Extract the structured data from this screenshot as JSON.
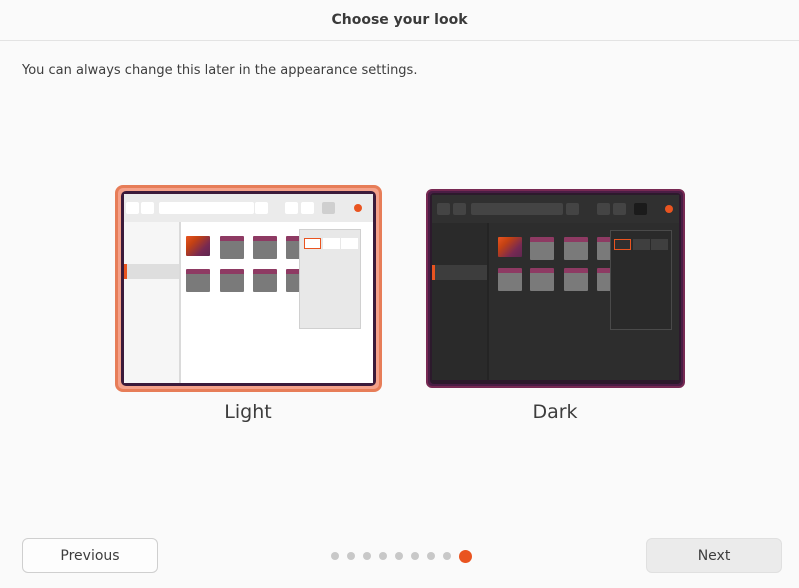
{
  "header": {
    "title": "Choose your look"
  },
  "subtitle": "You can always change this later in the appearance settings.",
  "themes": [
    {
      "label": "Light",
      "selected": true
    },
    {
      "label": "Dark",
      "selected": false
    }
  ],
  "footer": {
    "previous_label": "Previous",
    "next_label": "Next",
    "page_count": 9,
    "current_page": 9
  },
  "colors": {
    "accent": "#e95420",
    "selection_border": "#e77d58",
    "aubergine": "#772953"
  }
}
